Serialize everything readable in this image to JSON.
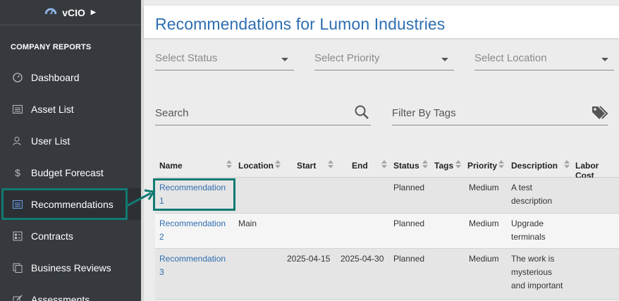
{
  "sidebar": {
    "brand": "vCIO",
    "section_title": "COMPANY REPORTS",
    "items": [
      {
        "label": "Dashboard",
        "icon": "gauge-icon"
      },
      {
        "label": "Asset List",
        "icon": "list-icon"
      },
      {
        "label": "User List",
        "icon": "user-icon"
      },
      {
        "label": "Budget Forecast",
        "icon": "dollar-icon"
      },
      {
        "label": "Recommendations",
        "icon": "list-icon",
        "active": true
      },
      {
        "label": "Contracts",
        "icon": "contract-icon"
      },
      {
        "label": "Business Reviews",
        "icon": "copy-icon"
      },
      {
        "label": "Assessments",
        "icon": "edit-icon"
      }
    ]
  },
  "page": {
    "title": "Recommendations for Lumon Industries"
  },
  "filters": {
    "status_placeholder": "Select Status",
    "priority_placeholder": "Select Priority",
    "location_placeholder": "Select Location",
    "search_placeholder": "Search",
    "tags_placeholder": "Filter By Tags"
  },
  "table": {
    "columns": [
      "Name",
      "Location",
      "Start",
      "End",
      "Status",
      "Tags",
      "Priority",
      "Description",
      "Labor Cost"
    ],
    "rows": [
      {
        "name": "Recommendation 1",
        "name_l1": "Recommendation",
        "name_l2": "1",
        "location": "",
        "start": "",
        "end": "",
        "status": "Planned",
        "tags": "",
        "priority": "Medium",
        "desc_l1": "A test",
        "desc_l2": "description",
        "desc_l3": ""
      },
      {
        "name": "Recommendation 2",
        "name_l1": "Recommendation",
        "name_l2": "2",
        "location": "Main",
        "start": "",
        "end": "",
        "status": "Planned",
        "tags": "",
        "priority": "Medium",
        "desc_l1": "Upgrade",
        "desc_l2": "terminals",
        "desc_l3": ""
      },
      {
        "name": "Recommendation 3",
        "name_l1": "Recommendation",
        "name_l2": "3",
        "location": "",
        "start": "2025-04-15",
        "end": "2025-04-30",
        "status": "Planned",
        "tags": "",
        "priority": "Medium",
        "desc_l1": "The work is",
        "desc_l2": "mysterious",
        "desc_l3": "and important"
      }
    ]
  },
  "colors": {
    "sidebar_bg": "#363a3f",
    "accent_blue": "#2e6eb0",
    "annotation_teal": "#127a72"
  }
}
